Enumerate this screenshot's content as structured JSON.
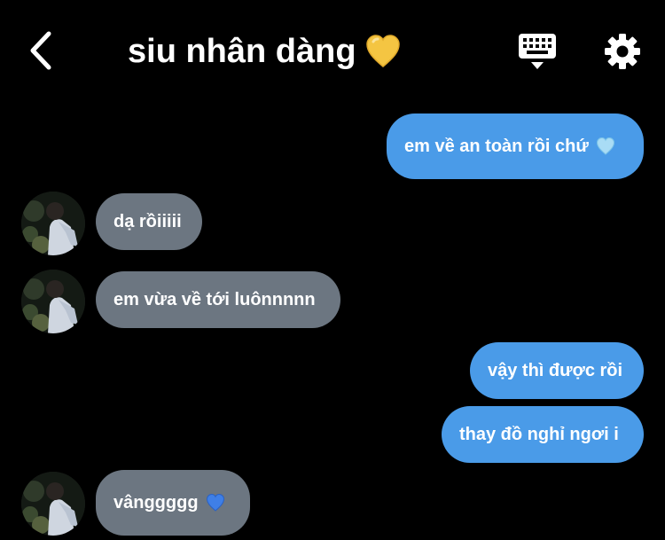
{
  "header": {
    "title": "siu nhân dàng",
    "title_emoji": "yellow-heart",
    "back_icon": "chevron-left-icon",
    "keyboard_icon": "keyboard-icon",
    "settings_icon": "gear-icon"
  },
  "messages": [
    {
      "direction": "outgoing",
      "text": "em về an toàn rồi chứ",
      "emoji": "light-blue-heart"
    },
    {
      "direction": "incoming",
      "text": "dạ rồiiiii"
    },
    {
      "direction": "incoming",
      "text": "em vừa về tới luônnnnn"
    },
    {
      "direction": "outgoing",
      "text": "vậy thì được rồi"
    },
    {
      "direction": "outgoing",
      "text": "thay đồ nghỉ ngơi i"
    },
    {
      "direction": "incoming",
      "text": "vânggggg",
      "emoji": "blue-heart"
    }
  ],
  "colors": {
    "background": "#000000",
    "outgoing_bubble": "#4a9be8",
    "incoming_bubble": "#6c7681",
    "text": "#ffffff"
  }
}
